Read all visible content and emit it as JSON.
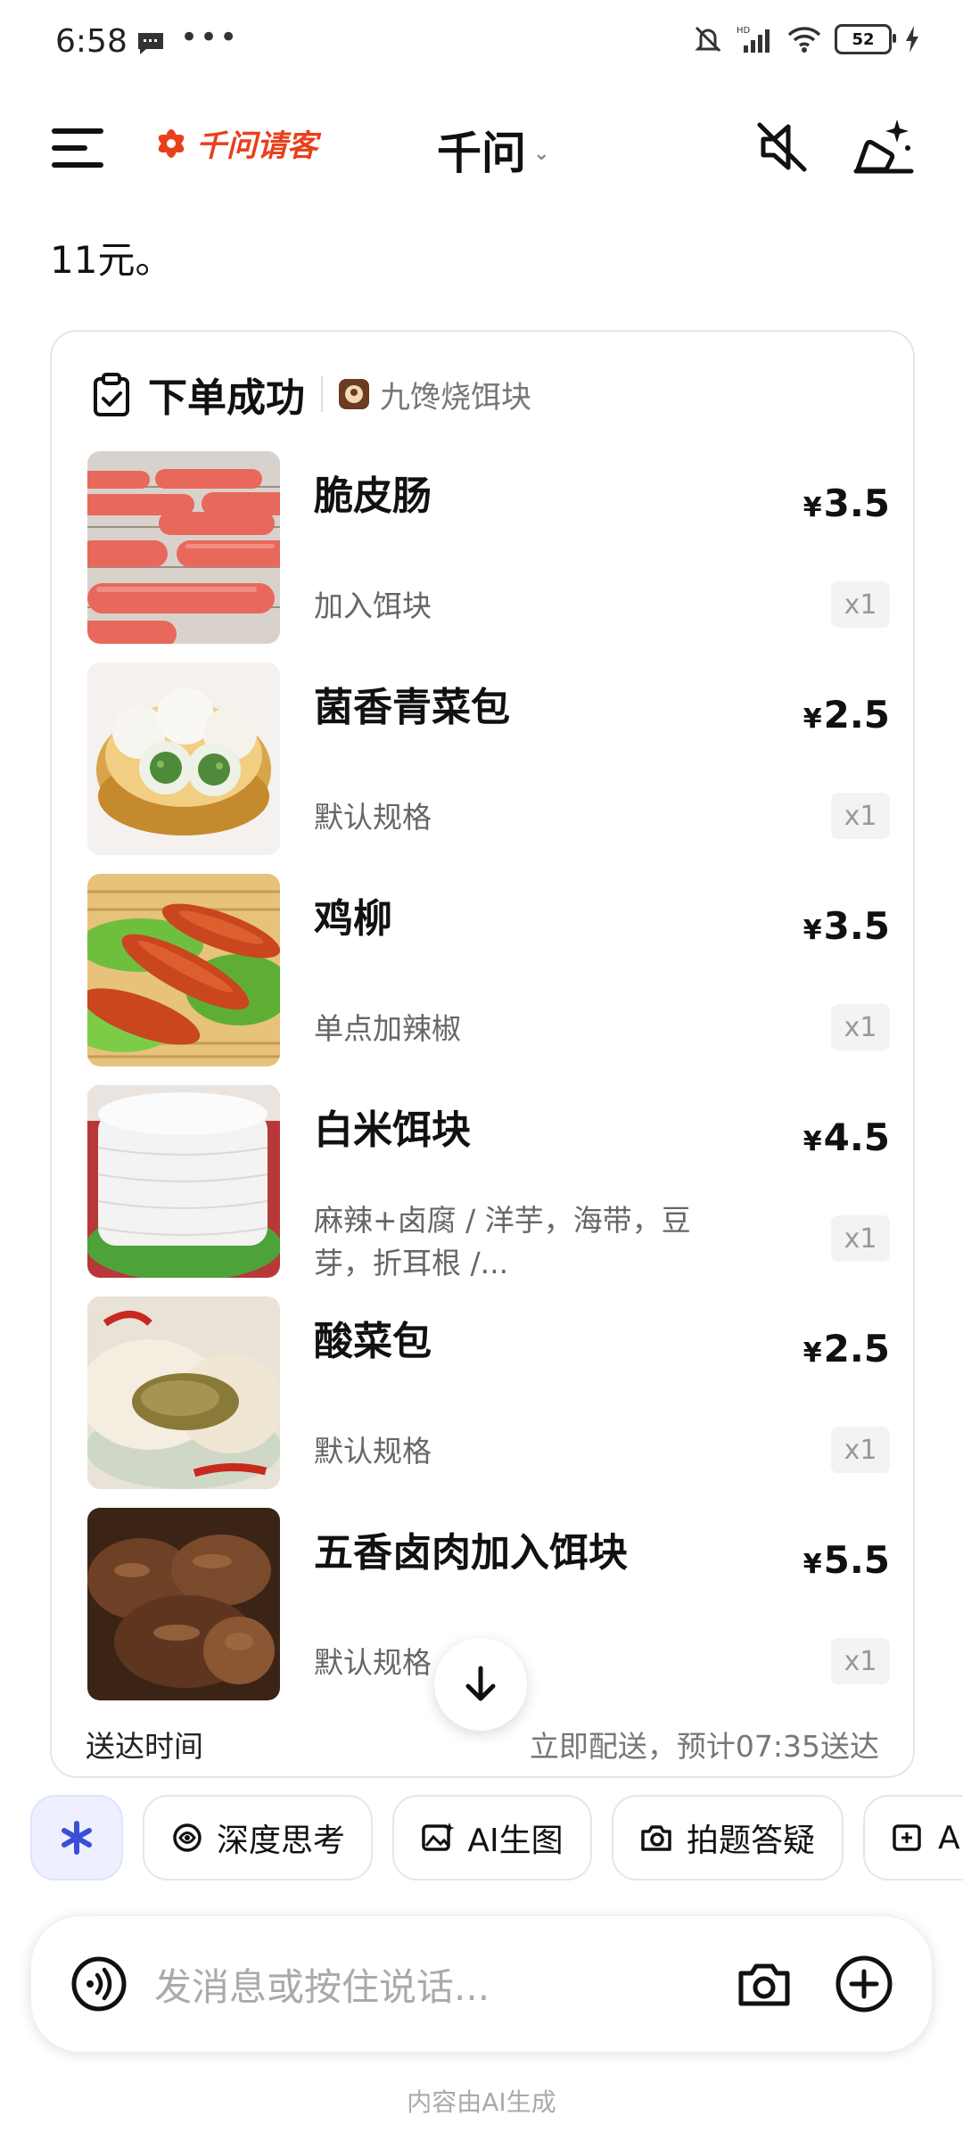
{
  "status_bar": {
    "time": "6:58",
    "battery": "52"
  },
  "header": {
    "logo": "千问请客",
    "title": "千问"
  },
  "answer_tail": "11元。",
  "order": {
    "title": "下单成功",
    "store": "九馋烧饵块",
    "items": [
      {
        "name": "脆皮肠",
        "spec": "加入饵块",
        "price": "3.5",
        "qty": "x1"
      },
      {
        "name": "菌香青菜包",
        "spec": "默认规格",
        "price": "2.5",
        "qty": "x1"
      },
      {
        "name": "鸡柳",
        "spec": "单点加辣椒",
        "price": "3.5",
        "qty": "x1"
      },
      {
        "name": "白米饵块",
        "spec": "麻辣+卤腐 / 洋芋，海带，豆芽，折耳根 /...",
        "price": "4.5",
        "qty": "x1"
      },
      {
        "name": "酸菜包",
        "spec": "默认规格",
        "price": "2.5",
        "qty": "x1"
      },
      {
        "name": "五香卤肉加入饵块",
        "spec": "默认规格",
        "price": "5.5",
        "qty": "x1"
      }
    ],
    "currency": "¥",
    "delivery_label": "送达时间",
    "delivery_value": "立即配送，预计07:35送达"
  },
  "chips": [
    "深度思考",
    "AI生图",
    "拍题答疑",
    "AI"
  ],
  "input": {
    "placeholder": "发消息或按住说话..."
  },
  "disclaimer": "内容由AI生成",
  "colors": {
    "brand": "#e8401c",
    "ai_chip": "#eef0ff",
    "ai_star": "#3a4fd8"
  }
}
